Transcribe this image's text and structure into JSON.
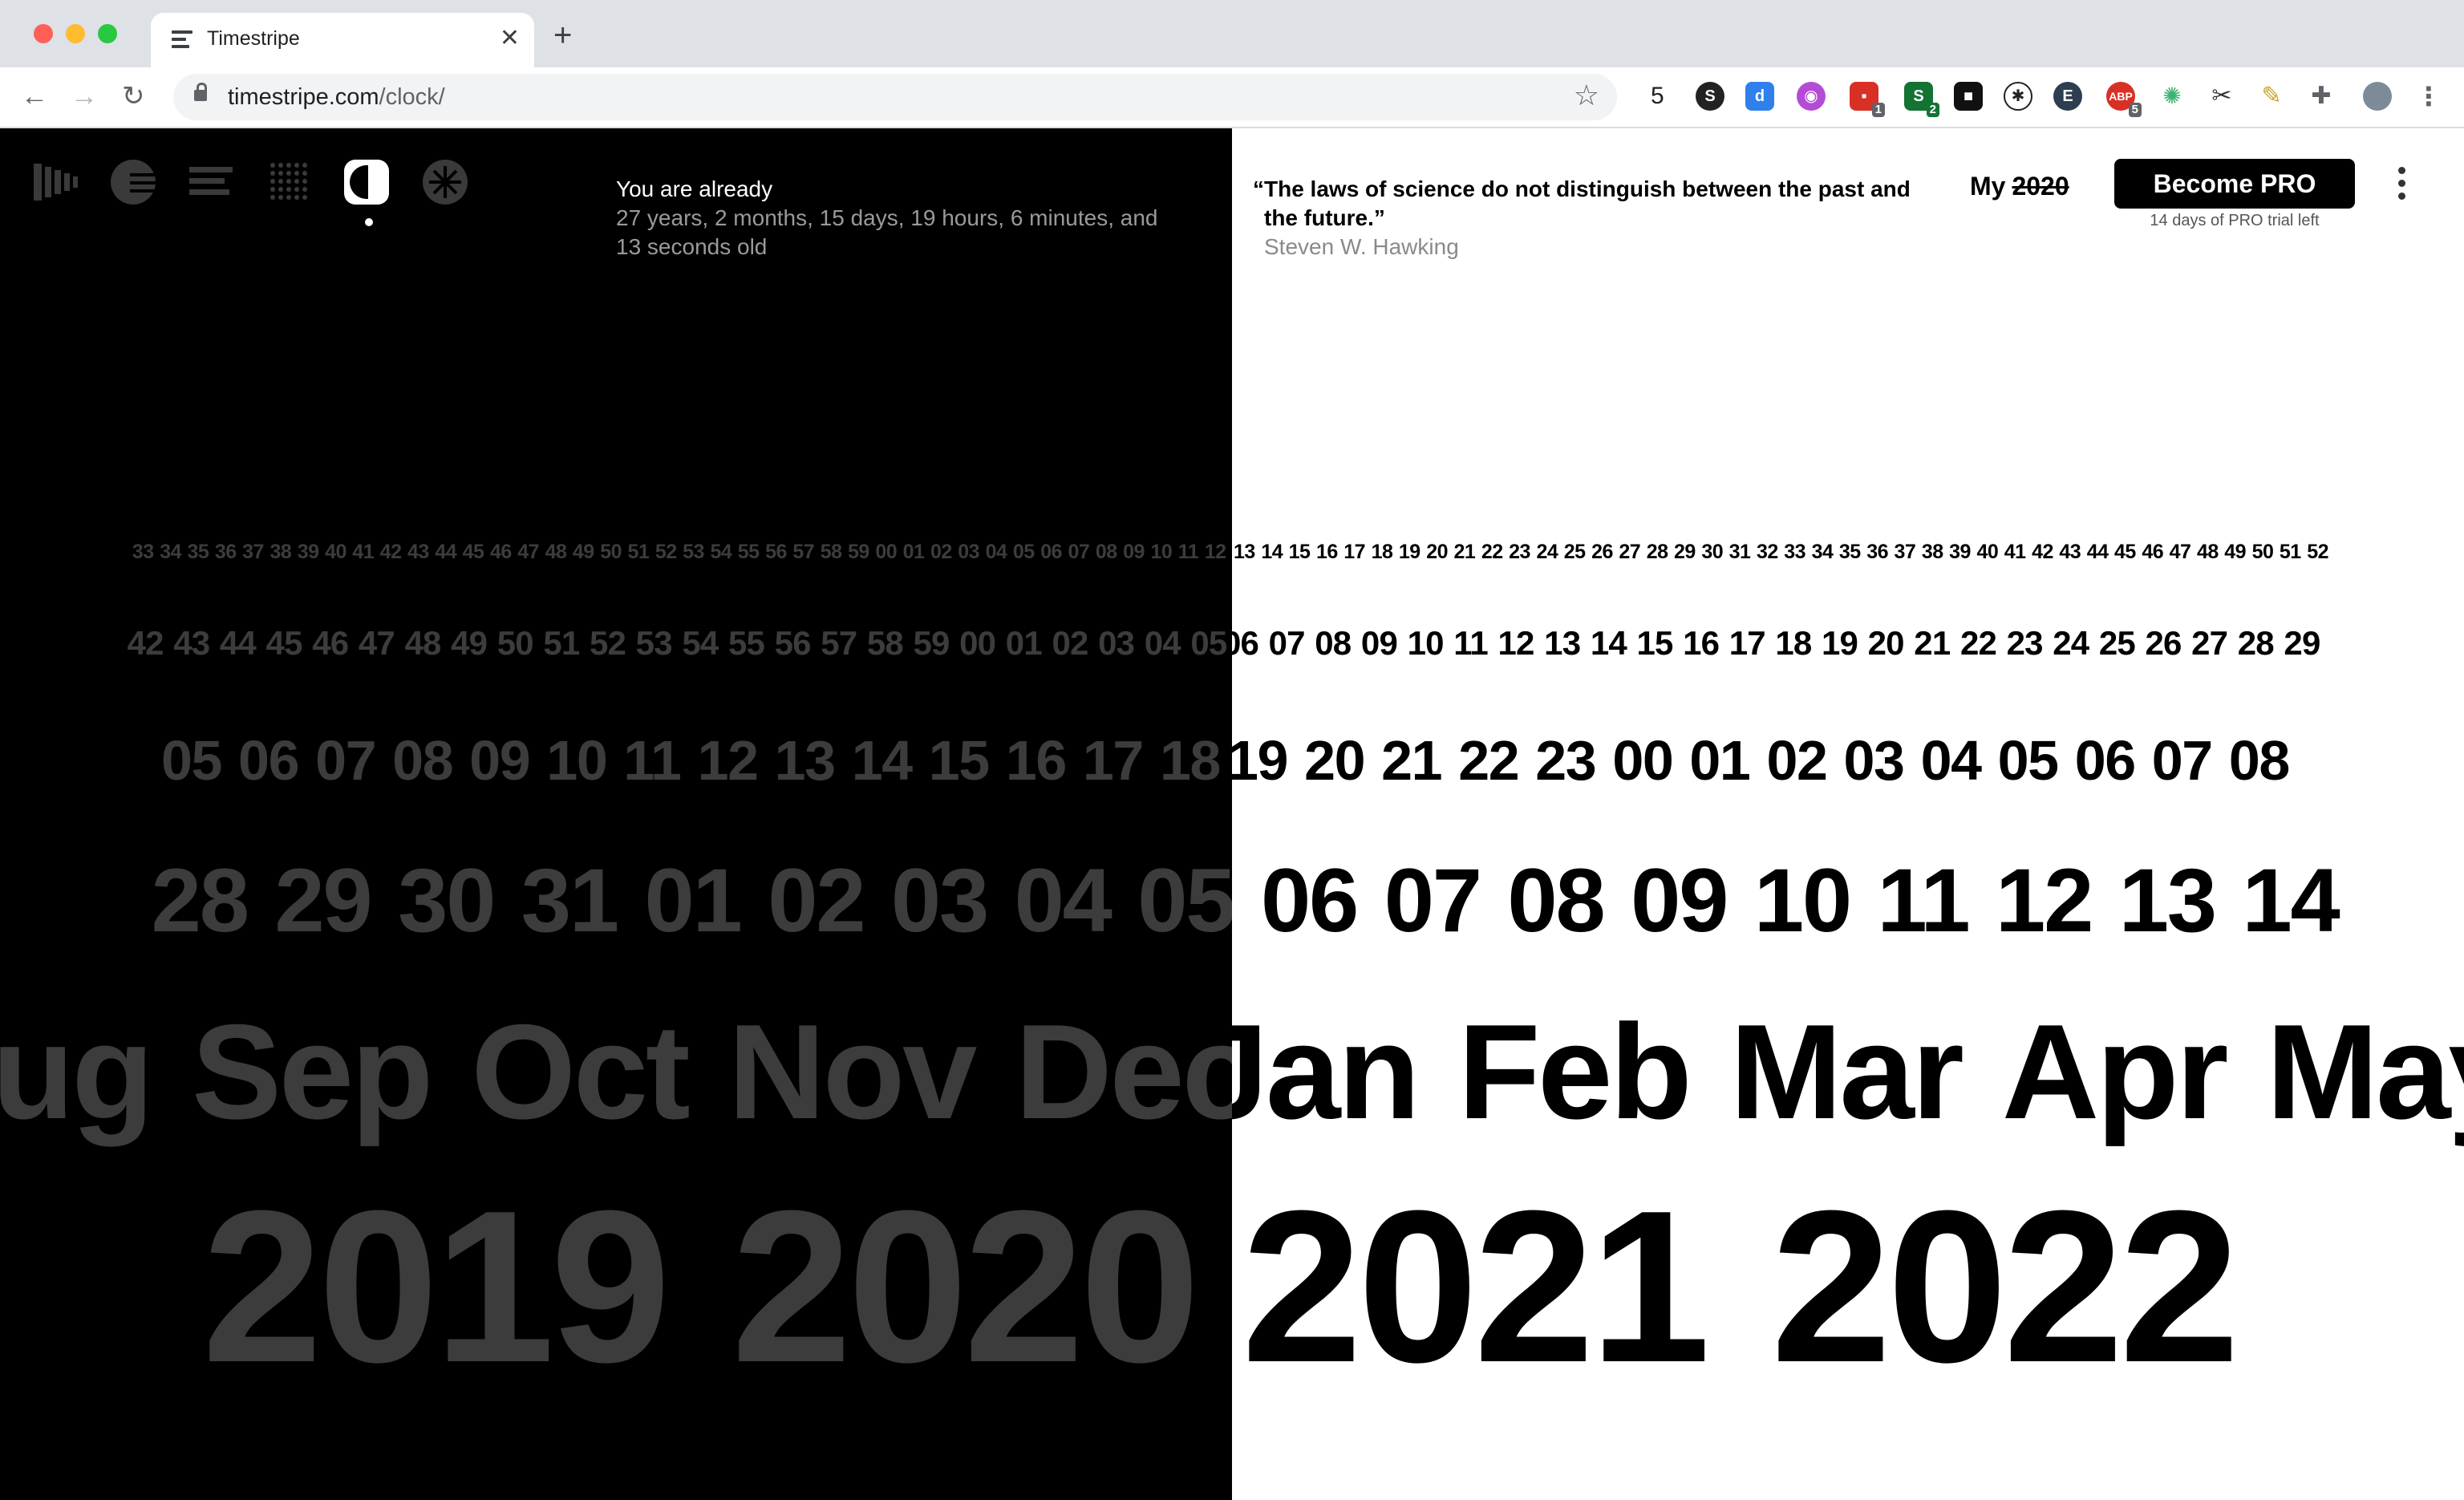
{
  "browser": {
    "tab_title": "Timestripe",
    "tab_close": "✕",
    "new_tab": "+",
    "nav_back": "←",
    "nav_forward": "→",
    "nav_reload": "↻",
    "url_domain": "timestripe.com",
    "url_path": "/clock/",
    "bookmark_star": "☆",
    "extension_count": "5",
    "extension_badges": [
      "1",
      "2",
      "5"
    ]
  },
  "header": {
    "age_heading": "You are already",
    "age_value": "27 years, 2 months, 15 days, 19 hours, 6 minutes, and 13 seconds old",
    "quote": "“The laws of science do not distinguish between the past and the future.”",
    "quote_author": "Steven W. Hawking",
    "my_label": "My",
    "my_year_struck": "2020",
    "pro_button": "Become PRO",
    "trial_note": "14 days of PRO trial left"
  },
  "colors": {
    "past_background": "#000000",
    "past_text": "#3c3c3c",
    "future_background": "#ffffff",
    "future_text": "#000000"
  },
  "stripes": {
    "seconds_past": [
      "33",
      "34",
      "35",
      "36",
      "37",
      "38",
      "39",
      "40",
      "41",
      "42",
      "43",
      "44",
      "45",
      "46",
      "47",
      "48",
      "49",
      "50",
      "51",
      "52",
      "53",
      "54",
      "55",
      "56",
      "57",
      "58",
      "59",
      "00",
      "01",
      "02",
      "03",
      "04",
      "05",
      "06",
      "07",
      "08",
      "09",
      "10",
      "11",
      "12"
    ],
    "seconds_future": [
      "13",
      "14",
      "15",
      "16",
      "17",
      "18",
      "19",
      "20",
      "21",
      "22",
      "23",
      "24",
      "25",
      "26",
      "27",
      "28",
      "29",
      "30",
      "31",
      "32",
      "33",
      "34",
      "35",
      "36",
      "37",
      "38",
      "39",
      "40",
      "41",
      "42",
      "43",
      "44",
      "45",
      "46",
      "47",
      "48",
      "49",
      "50",
      "51",
      "52"
    ],
    "minutes_past": [
      "42",
      "43",
      "44",
      "45",
      "46",
      "47",
      "48",
      "49",
      "50",
      "51",
      "52",
      "53",
      "54",
      "55",
      "56",
      "57",
      "58",
      "59",
      "00",
      "01",
      "02",
      "03",
      "04",
      "05"
    ],
    "minutes_future": [
      "06",
      "07",
      "08",
      "09",
      "10",
      "11",
      "12",
      "13",
      "14",
      "15",
      "16",
      "17",
      "18",
      "19",
      "20",
      "21",
      "22",
      "23",
      "24",
      "25",
      "26",
      "27",
      "28",
      "29"
    ],
    "hours_past": [
      "05",
      "06",
      "07",
      "08",
      "09",
      "10",
      "11",
      "12",
      "13",
      "14",
      "15",
      "16",
      "17",
      "18"
    ],
    "hours_future": [
      "19",
      "20",
      "21",
      "22",
      "23",
      "00",
      "01",
      "02",
      "03",
      "04",
      "05",
      "06",
      "07",
      "08"
    ],
    "days_past": [
      "28",
      "29",
      "30",
      "31",
      "01",
      "02",
      "03",
      "04",
      "05"
    ],
    "days_future": [
      "06",
      "07",
      "08",
      "09",
      "10",
      "11",
      "12",
      "13",
      "14"
    ],
    "months_past": [
      "Aug",
      "Sep",
      "Oct",
      "Nov",
      "Dec"
    ],
    "months_future": [
      "Jan",
      "Feb",
      "Mar",
      "Apr",
      "May"
    ],
    "years_past": [
      "2019",
      "2020"
    ],
    "years_future": [
      "2021",
      "2022"
    ]
  }
}
